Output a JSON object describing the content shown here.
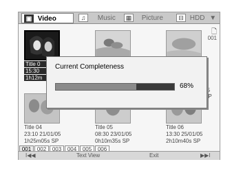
{
  "tabs": [
    {
      "label": "Video",
      "icon": "video-icon",
      "glyph": "▣",
      "active": true
    },
    {
      "label": "Music",
      "icon": "music-icon",
      "glyph": "♫",
      "active": false
    },
    {
      "label": "Picture",
      "icon": "picture-icon",
      "glyph": "▦",
      "active": false
    },
    {
      "label": "HDD",
      "icon": "hdd-icon",
      "glyph": "⊟",
      "active": false,
      "dropdown": "▼"
    }
  ],
  "side_label": "001",
  "titles": [
    {
      "name": "Title 0",
      "time": "15:30",
      "length": "1h12m",
      "selected": true
    },
    {
      "name": "",
      "time": "",
      "length": "",
      "selected": false
    },
    {
      "name": "",
      "time": "01/05",
      "length": "SP",
      "selected": false
    },
    {
      "name": "Title 04",
      "time": "23:10  21/01/05",
      "length": "1h25m05s  SP",
      "selected": false
    },
    {
      "name": "Title 05",
      "time": "08:30  23/01/05",
      "length": "0h10m35s  SP",
      "selected": false
    },
    {
      "name": "Title 06",
      "time": "13:30  25/01/05",
      "length": "2h10m40s  SP",
      "selected": false
    }
  ],
  "modal": {
    "title": "Current Completeness",
    "percent_text": "68%",
    "progress": 0.68
  },
  "pages": [
    "001",
    "002",
    "003",
    "004",
    "005",
    "006"
  ],
  "bottom": {
    "prev": "I◀◀",
    "text_view": "Text View",
    "exit": "Exit",
    "next": "▶▶I"
  }
}
